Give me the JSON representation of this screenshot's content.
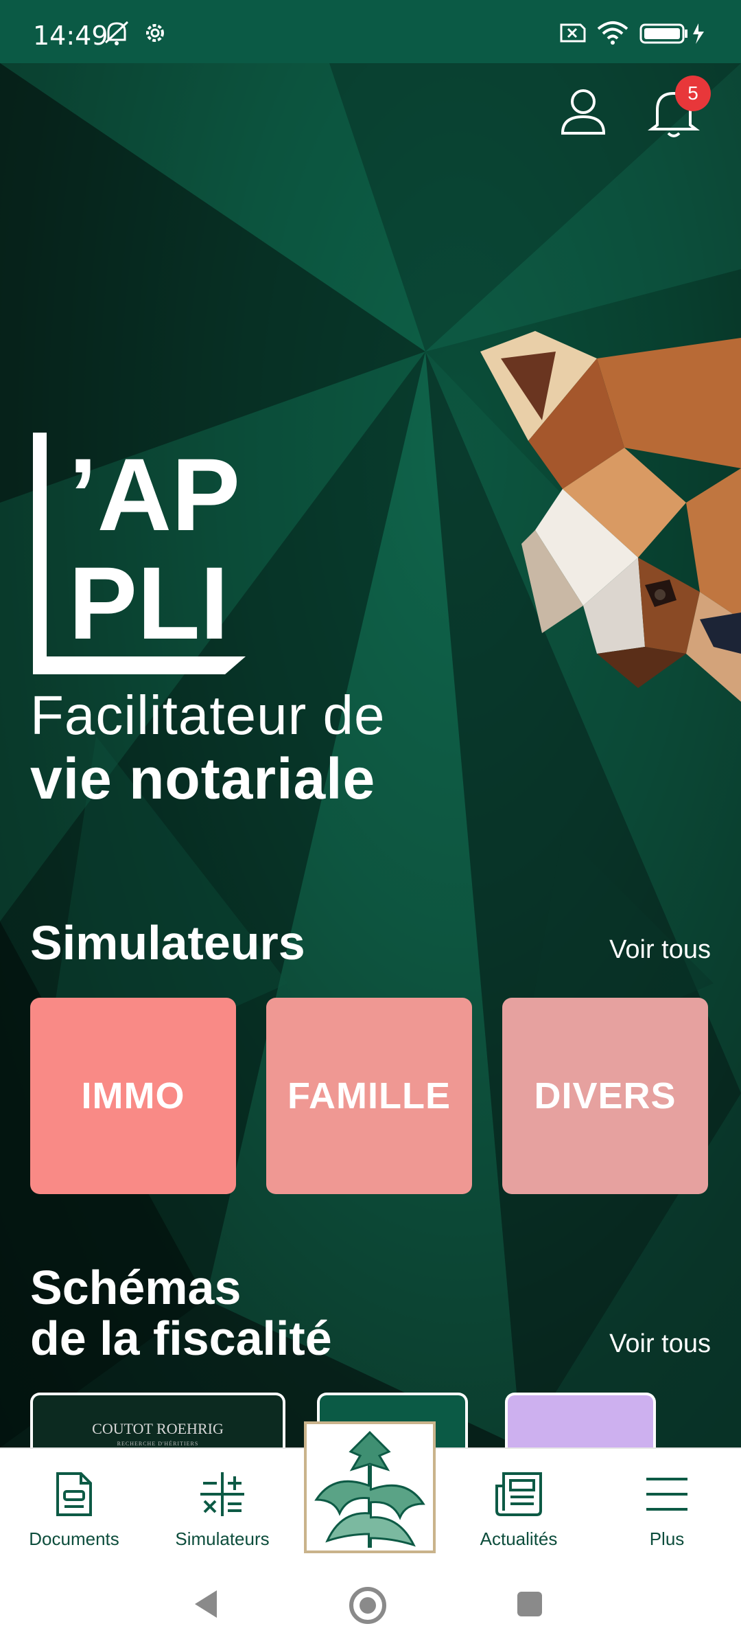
{
  "status_bar": {
    "time": "14:49"
  },
  "header": {
    "notification_count": "5"
  },
  "hero": {
    "logo_line1": "’AP",
    "logo_line2": "PLI",
    "tagline_line1": "Facilitateur de",
    "tagline_line2": "vie notariale"
  },
  "simulateurs": {
    "title": "Simulateurs",
    "see_all": "Voir tous",
    "cards": [
      {
        "label": "IMMO",
        "color": "#f98a86"
      },
      {
        "label": "FAMILLE",
        "color": "#ef9893"
      },
      {
        "label": "DIVERS",
        "color": "#e6a19f"
      }
    ]
  },
  "schemas": {
    "title_line1": "Schémas",
    "title_line2": "de la fiscalité",
    "see_all": "Voir tous",
    "cards": [
      {
        "label": "COUTOT ROEHRIG",
        "subtitle": "RECHERCHE D'HÉRITIERS",
        "color": "#0c2a20"
      },
      {
        "color": "#0b5a45"
      },
      {
        "color": "#cdb0ef"
      }
    ]
  },
  "bottom_nav": {
    "items": [
      {
        "label": "Documents",
        "icon": "document-icon"
      },
      {
        "label": "Simulateurs",
        "icon": "calculator-icon"
      },
      {
        "label": "Actualités",
        "icon": "newspaper-icon"
      },
      {
        "label": "Plus",
        "icon": "menu-icon"
      }
    ]
  },
  "colors": {
    "brand_green": "#0b5a45",
    "badge_red": "#e8373a"
  }
}
